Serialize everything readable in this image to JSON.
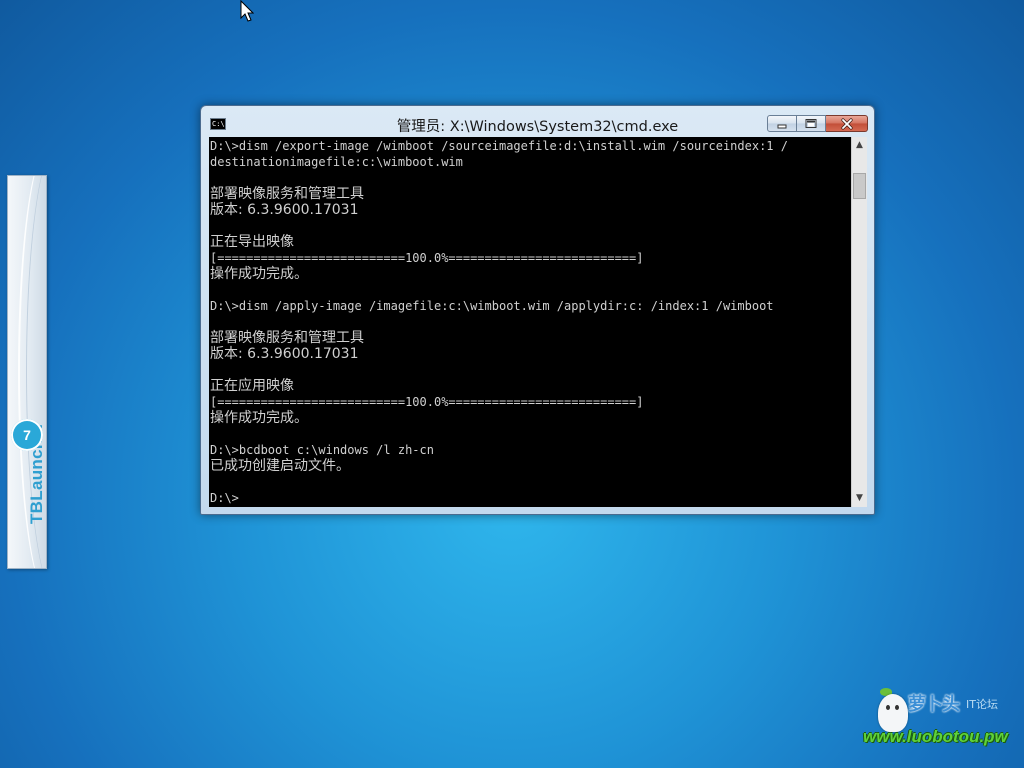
{
  "launcher": {
    "title": "TBLauncher",
    "logo_glyph": "7",
    "accent_color": "#2f9fd0"
  },
  "window": {
    "icon": "cmd-icon",
    "icon_glyph": "C:\\",
    "title": "管理员: X:\\Windows\\System32\\cmd.exe",
    "controls": {
      "minimize": "minimize-icon",
      "maximize": "maximize-icon",
      "close": "close-icon"
    }
  },
  "console": {
    "background": "#000000",
    "foreground": "#d0d0d0",
    "lines": [
      "D:\\>dism /export-image /wimboot /sourceimagefile:d:\\install.wim /sourceindex:1 /",
      "destinationimagefile:c:\\wimboot.wim",
      "",
      "部署映像服务和管理工具",
      "版本: 6.3.9600.17031",
      "",
      "正在导出映像",
      "[==========================100.0%==========================]",
      "操作成功完成。",
      "",
      "D:\\>dism /apply-image /imagefile:c:\\wimboot.wim /applydir:c: /index:1 /wimboot",
      "",
      "部署映像服务和管理工具",
      "版本: 6.3.9600.17031",
      "",
      "正在应用映像",
      "[==========================100.0%==========================]",
      "操作成功完成。",
      "",
      "D:\\>bcdboot c:\\windows /l zh-cn",
      "已成功创建启动文件。",
      "",
      "D:\\>"
    ]
  },
  "watermark": {
    "brand": "萝卜头",
    "suffix": "IT论坛",
    "url": "www.luobotou.pw"
  }
}
